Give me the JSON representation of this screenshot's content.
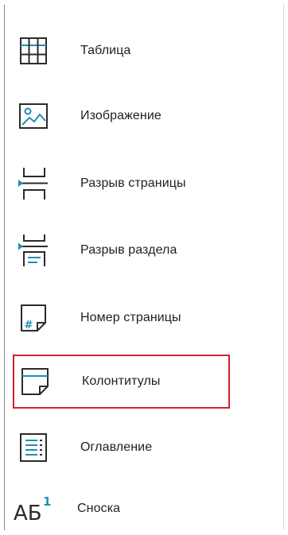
{
  "menu": {
    "items": [
      {
        "label": "Таблица",
        "icon": "table-icon"
      },
      {
        "label": "Изображение",
        "icon": "image-icon"
      },
      {
        "label": "Разрыв страницы",
        "icon": "page-break-icon"
      },
      {
        "label": "Разрыв раздела",
        "icon": "section-break-icon"
      },
      {
        "label": "Номер страницы",
        "icon": "page-number-icon"
      },
      {
        "label": "Колонтитулы",
        "icon": "header-footer-icon",
        "highlighted": true
      },
      {
        "label": "Оглавление",
        "icon": "table-of-contents-icon"
      },
      {
        "label": "Сноска",
        "icon": "footnote-icon",
        "icon_text": "АБ",
        "icon_superscript": "1"
      }
    ]
  },
  "colors": {
    "icon_stroke": "#2b2b2b",
    "icon_accent": "#1e8fb6",
    "highlight_border": "#d1232e"
  }
}
